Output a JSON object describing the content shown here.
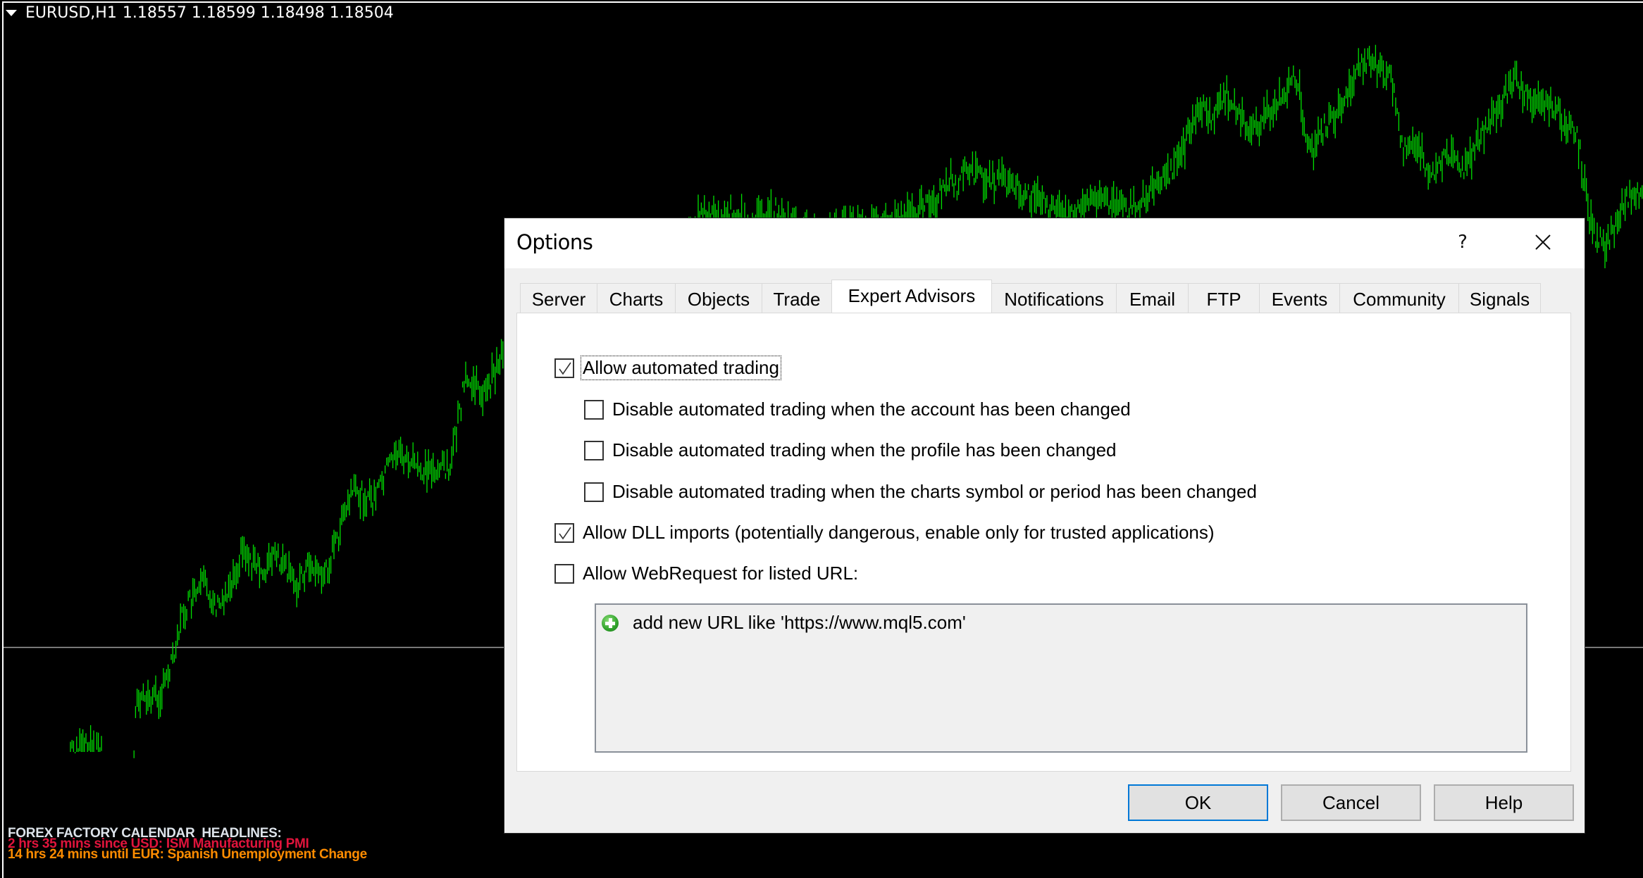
{
  "chart": {
    "symbol": "EURUSD,H1",
    "ohlc": "1.18557 1.18599 1.18498 1.18504",
    "bar_color": "#00e000",
    "background": "#000000",
    "hline_color": "#a0a0a0",
    "news": {
      "header": "FOREX FACTORY CALENDAR  HEADLINES:",
      "items": [
        {
          "text": "2 hrs 35 mins since USD: ISM Manufacturing PMI",
          "color": "#e0143c"
        },
        {
          "text": "14 hrs 24 mins until EUR: Spanish Unemployment Change",
          "color": "#ff8c00"
        }
      ],
      "header_color": "#dde3ea"
    }
  },
  "dialog": {
    "title": "Options",
    "help_label": "?",
    "tabs": [
      {
        "label": "Server",
        "active": false
      },
      {
        "label": "Charts",
        "active": false
      },
      {
        "label": "Objects",
        "active": false
      },
      {
        "label": "Trade",
        "active": false
      },
      {
        "label": "Expert Advisors",
        "active": true
      },
      {
        "label": "Notifications",
        "active": false
      },
      {
        "label": "Email",
        "active": false
      },
      {
        "label": "FTP",
        "active": false
      },
      {
        "label": "Events",
        "active": false
      },
      {
        "label": "Community",
        "active": false
      },
      {
        "label": "Signals",
        "active": false
      }
    ],
    "options": [
      {
        "label": "Allow automated trading",
        "checked": true
      },
      {
        "label": "Disable automated trading when the account has been changed",
        "checked": false
      },
      {
        "label": "Disable automated trading when the profile has been changed",
        "checked": false
      },
      {
        "label": "Disable automated trading when the charts symbol or period has been changed",
        "checked": false
      },
      {
        "label": "Allow DLL imports (potentially dangerous, enable only for trusted applications)",
        "checked": true
      },
      {
        "label": "Allow WebRequest for listed URL:",
        "checked": false
      }
    ],
    "url_list": {
      "add_item_label": "add new URL like 'https://www.mql5.com'"
    },
    "buttons": {
      "ok": "OK",
      "cancel": "Cancel",
      "help": "Help"
    },
    "accent_color": "#0078d7"
  }
}
